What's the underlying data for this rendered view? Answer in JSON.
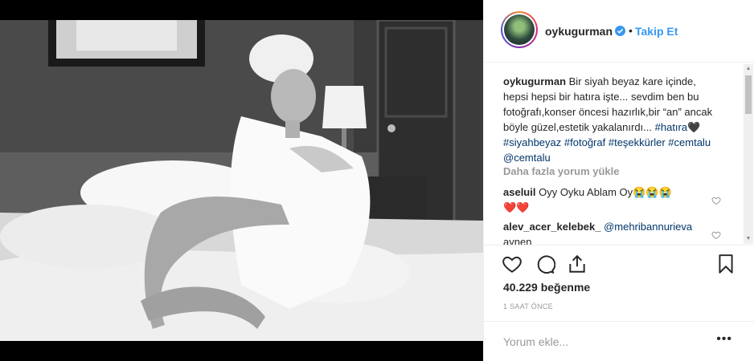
{
  "post": {
    "username": "oykugurman",
    "follow_label": "Takip Et",
    "dot": "•"
  },
  "caption": {
    "username": "oykugurman",
    "text": "Bir siyah beyaz kare içinde, hepsi hepsi bir hatıra işte... sevdim ben bu fotoğrafı,konser öncesi hazırlık,bir “an” ancak böyle güzel,estetik yakalanırdı...",
    "tags": [
      "#hatıra🖤",
      "#siyahbeyaz",
      "#fotoğraf",
      "#teşekkürler",
      "#cemtalu",
      "@cemtalu"
    ]
  },
  "load_more": "Daha fazla yorum yükle",
  "comments": [
    {
      "user": "aseluil",
      "text": "Oyy Oyku Ablam Oy😭😭😭",
      "text2": "❤️❤️"
    },
    {
      "user": "alev_acer_kelebek_",
      "mention": "@mehribannurieva",
      "text2": "aynen"
    }
  ],
  "likes": "40.229 beğenme",
  "time": "1 SAAT ÖNCE",
  "add_comment_placeholder": "Yorum ekle...",
  "more_label": "•••",
  "colors": {
    "link": "#3897f0",
    "tag": "#003569",
    "muted": "#999999"
  }
}
